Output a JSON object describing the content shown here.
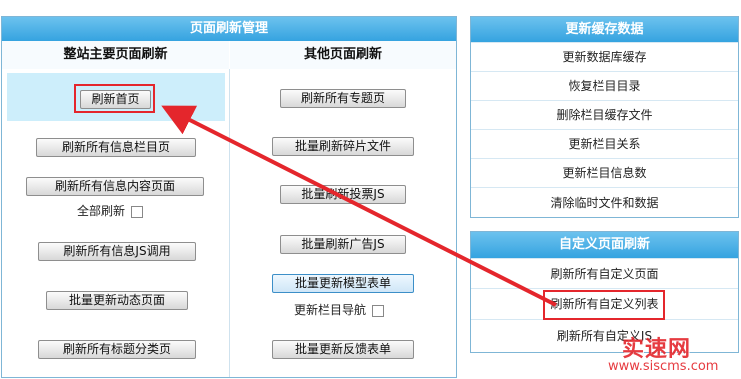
{
  "main_panel": {
    "title": "页面刷新管理",
    "col_left_title": "整站主要页面刷新",
    "col_right_title": "其他页面刷新",
    "left_buttons": {
      "refresh_home": "刷新首页",
      "refresh_all_column_pages": "刷新所有信息栏目页",
      "refresh_all_content_pages": "刷新所有信息内容页面",
      "refresh_all_js": "刷新所有信息JS调用",
      "batch_update_dynamic": "批量更新动态页面",
      "refresh_all_title_category": "刷新所有标题分类页"
    },
    "full_refresh_label": "全部刷新",
    "right_buttons": {
      "refresh_all_topic": "刷新所有专题页",
      "batch_refresh_fragment": "批量刷新碎片文件",
      "batch_refresh_vote_js": "批量刷新投票JS",
      "batch_refresh_ad_js": "批量刷新广告JS",
      "batch_update_model_form": "批量更新模型表单",
      "batch_update_feedback_form": "批量更新反馈表单"
    },
    "update_nav_label": "更新栏目导航"
  },
  "cache_panel": {
    "title": "更新缓存数据",
    "items": [
      "更新数据库缓存",
      "恢复栏目目录",
      "删除栏目缓存文件",
      "更新栏目关系",
      "更新栏目信息数",
      "清除临时文件和数据"
    ]
  },
  "custom_panel": {
    "title": "自定义页面刷新",
    "items": [
      "刷新所有自定义页面",
      "刷新所有自定义列表",
      "刷新所有自定义JS"
    ]
  },
  "watermark": {
    "name": "实速网",
    "url": "www.siscms.com"
  },
  "colors": {
    "header_blue": "#35a3e0",
    "highlight_red": "#e4262c",
    "selected_cell": "#cdeefb"
  }
}
